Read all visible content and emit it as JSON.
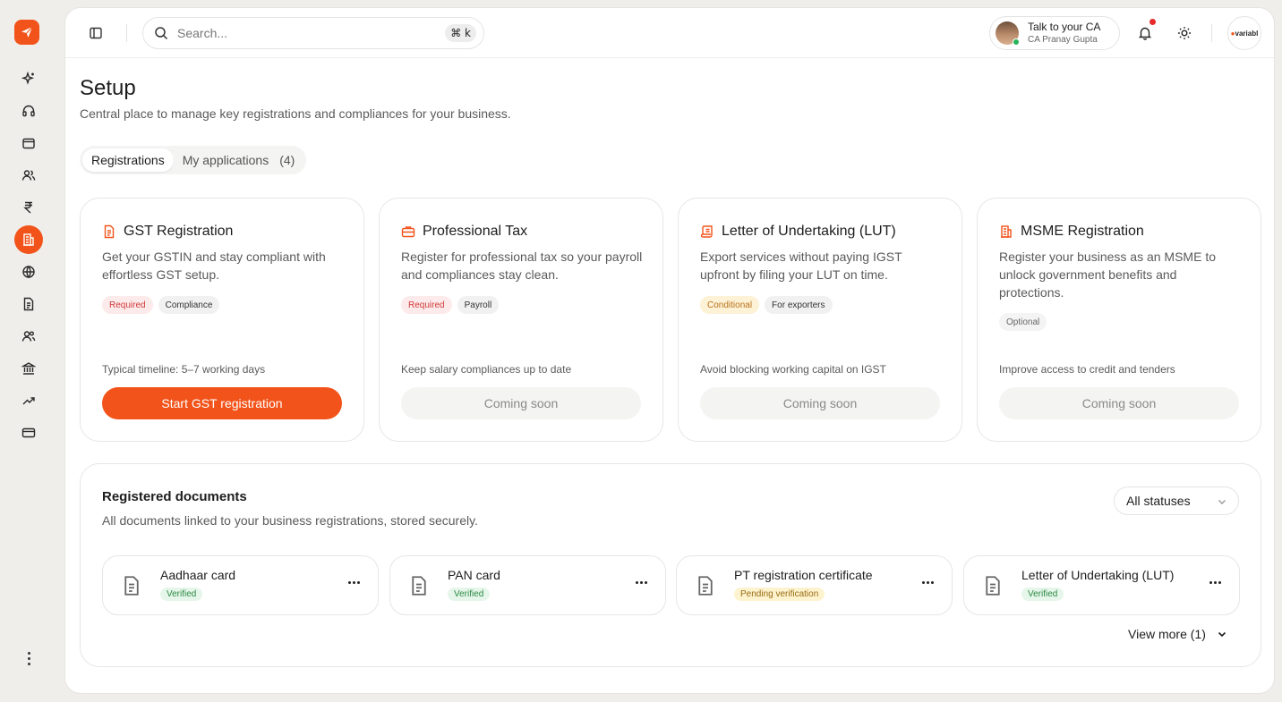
{
  "topbar": {
    "search_placeholder": "Search...",
    "shortcut": "⌘ k",
    "ca": {
      "title": "Talk to your CA",
      "name": "CA Pranay Gupta"
    },
    "org_logo": {
      "dot": "●",
      "text": "variabl"
    }
  },
  "rail": {
    "items": [
      "sparkles-icon",
      "headphones-icon",
      "wallet-icon",
      "users-icon",
      "rupee-icon",
      "building-icon",
      "globe-icon",
      "document-icon",
      "team-icon",
      "bank-icon",
      "trending-up-icon",
      "credit-card-icon"
    ],
    "active": "building-icon"
  },
  "page": {
    "title": "Setup",
    "subtitle": "Central place to manage key registrations and compliances for your business."
  },
  "tabs": [
    {
      "label": "Registrations",
      "active": true
    },
    {
      "label": "My applications",
      "count": "(4)",
      "active": false
    }
  ],
  "cards": [
    {
      "title": "GST Registration",
      "desc": "Get your GSTIN and stay compliant with effortless GST setup.",
      "chips": [
        "Required",
        "Compliance"
      ],
      "note": "Typical timeline: 5–7 working days",
      "button": "Start GST registration"
    },
    {
      "title": "Professional Tax",
      "desc": "Register for professional tax so your payroll and compliances stay clean.",
      "chips": [
        "Required",
        "Payroll"
      ],
      "note": "Keep salary compliances up to date",
      "button": "Coming soon"
    },
    {
      "title": "Letter of Undertaking (LUT)",
      "desc": "Export services without paying IGST upfront by filing your LUT on time.",
      "chips": [
        "Conditional",
        "For exporters"
      ],
      "note": "Avoid blocking working capital on IGST",
      "button": "Coming soon"
    },
    {
      "title": "MSME Registration",
      "desc": "Register your business as an MSME to unlock government benefits and protections.",
      "chips": [
        "Optional"
      ],
      "note": "Improve access to credit and tenders",
      "button": "Coming soon"
    }
  ],
  "documents": {
    "title": "Registered documents",
    "subtitle": "All documents linked to your business registrations, stored securely.",
    "filter": "All statuses",
    "items": [
      {
        "name": "Aadhaar card",
        "status": "Verified"
      },
      {
        "name": "PAN card",
        "status": "Verified"
      },
      {
        "name": "PT registration certificate",
        "status": "Pending verification"
      },
      {
        "name": "Letter of Undertaking (LUT)",
        "status": "Verified"
      }
    ],
    "view_more": "View more (1)"
  },
  "colors": {
    "accent": "#f2531a",
    "verified": "#2c8a44",
    "pending": "#9a6b12",
    "required": "#d03a3a"
  }
}
